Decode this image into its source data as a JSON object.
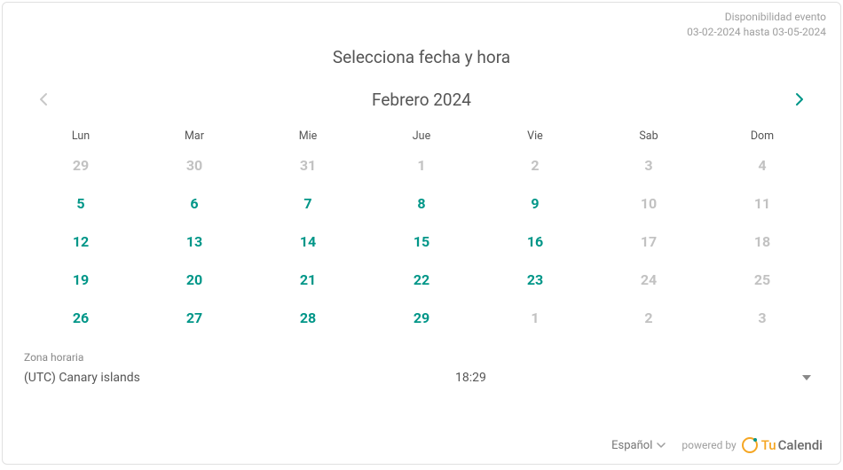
{
  "availability": {
    "label": "Disponibilidad evento",
    "range": "03-02-2024 hasta 03-05-2024"
  },
  "page_title": "Selecciona fecha y hora",
  "month_title": "Febrero 2024",
  "weekdays": [
    "Lun",
    "Mar",
    "Mie",
    "Jue",
    "Vie",
    "Sab",
    "Dom"
  ],
  "dates": [
    {
      "n": "29",
      "a": false
    },
    {
      "n": "30",
      "a": false
    },
    {
      "n": "31",
      "a": false
    },
    {
      "n": "1",
      "a": false
    },
    {
      "n": "2",
      "a": false
    },
    {
      "n": "3",
      "a": false
    },
    {
      "n": "4",
      "a": false
    },
    {
      "n": "5",
      "a": true
    },
    {
      "n": "6",
      "a": true
    },
    {
      "n": "7",
      "a": true
    },
    {
      "n": "8",
      "a": true
    },
    {
      "n": "9",
      "a": true
    },
    {
      "n": "10",
      "a": false
    },
    {
      "n": "11",
      "a": false
    },
    {
      "n": "12",
      "a": true
    },
    {
      "n": "13",
      "a": true
    },
    {
      "n": "14",
      "a": true
    },
    {
      "n": "15",
      "a": true
    },
    {
      "n": "16",
      "a": true
    },
    {
      "n": "17",
      "a": false
    },
    {
      "n": "18",
      "a": false
    },
    {
      "n": "19",
      "a": true
    },
    {
      "n": "20",
      "a": true
    },
    {
      "n": "21",
      "a": true
    },
    {
      "n": "22",
      "a": true
    },
    {
      "n": "23",
      "a": true
    },
    {
      "n": "24",
      "a": false
    },
    {
      "n": "25",
      "a": false
    },
    {
      "n": "26",
      "a": true
    },
    {
      "n": "27",
      "a": true
    },
    {
      "n": "28",
      "a": true
    },
    {
      "n": "29",
      "a": true
    },
    {
      "n": "1",
      "a": false
    },
    {
      "n": "2",
      "a": false
    },
    {
      "n": "3",
      "a": false
    }
  ],
  "timezone": {
    "label": "Zona horaria",
    "name": "(UTC) Canary islands",
    "time": "18:29"
  },
  "footer": {
    "language": "Español",
    "powered": "powered by",
    "brand_tu": "Tu",
    "brand_cal": "Calendi"
  }
}
